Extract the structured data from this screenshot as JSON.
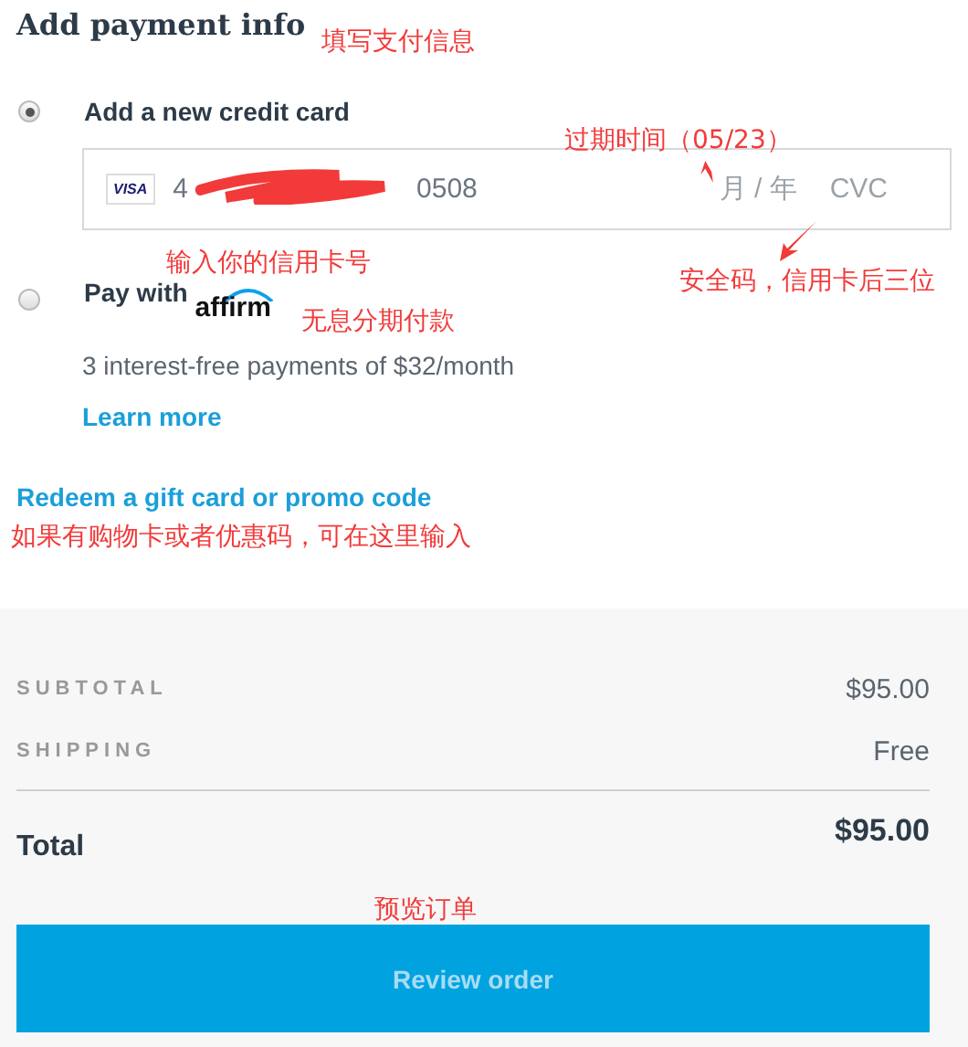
{
  "title": "Add payment info",
  "options": [
    {
      "kind": "card",
      "label": "Add a new credit card",
      "selected": true,
      "card_brand": "VISA",
      "card_number_start": "4",
      "card_number_end": "0508",
      "expiry_placeholder": "月 / 年",
      "cvc_placeholder": "CVC"
    },
    {
      "kind": "affirm",
      "label": "Pay with",
      "brand": "affirm",
      "selected": false,
      "detail": "3 interest-free payments of $32/month",
      "link": "Learn more"
    }
  ],
  "promo_link": "Redeem a gift card or promo code",
  "summary": {
    "rows": [
      {
        "label": "SUBTOTAL",
        "value": "$95.00"
      },
      {
        "label": "SHIPPING",
        "value": "Free"
      }
    ],
    "total_label": "Total",
    "total_value": "$95.00",
    "button": "Review order"
  },
  "annotations": [
    "填写支付信息",
    "过期时间（05/23）",
    "输入你的信用卡号",
    "安全码，信用卡后三位",
    "无息分期付款",
    "如果有购物卡或者优惠码，可在这里输入",
    "预览订单"
  ]
}
